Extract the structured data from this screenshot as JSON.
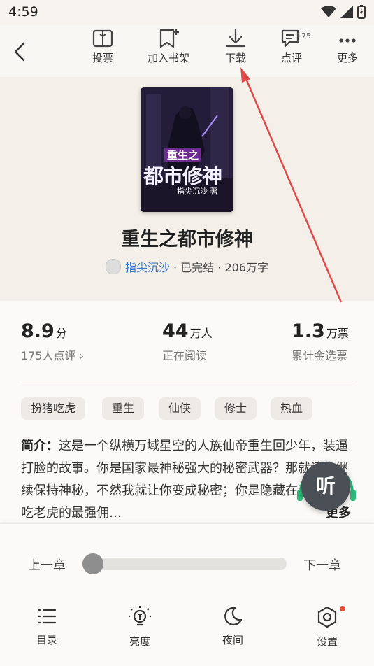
{
  "status": {
    "time": "4:59"
  },
  "toolbar": {
    "vote": "投票",
    "add_shelf": "加入书架",
    "download": "下载",
    "comments": "点评",
    "comments_badge": "175",
    "more": "更多"
  },
  "book": {
    "title": "重生之都市修神",
    "author": "指尖沉沙",
    "meta_rest": " · 已完结 · 206万字",
    "cover_text_small": "重生之",
    "cover_text_big": "都市修神",
    "cover_author": "指尖沉沙 著"
  },
  "stats": {
    "rating": {
      "num": "8.9",
      "unit": "分",
      "sub": "175人点评 ›"
    },
    "readers": {
      "num": "44",
      "unit": "万人",
      "sub": "正在阅读"
    },
    "votes": {
      "num": "1.3",
      "unit": "万票",
      "sub": "累计金选票"
    }
  },
  "tags": [
    "扮猪吃虎",
    "重生",
    "仙侠",
    "修士",
    "热血"
  ],
  "intro": {
    "label": "简介：",
    "text": "这是一个纵横万域星空的人族仙帝重生回少年，装逼打脸的故事。你是国家最神秘强大的秘密武器？那就请你继续保持神秘，不然我就让你变成秘密；你是隐藏在都市扮猪吃老虎的最强佣…",
    "more": "更多"
  },
  "listen": "听",
  "reader": {
    "prev": "上一章",
    "next": "下一章",
    "progress": 0.0
  },
  "bottom_nav": {
    "toc": "目录",
    "brightness": "亮度",
    "night": "夜间",
    "settings": "设置"
  },
  "colors": {
    "accent_link": "#3b78c4",
    "arrow": "#e04848",
    "badge_dot": "#e84a3a"
  }
}
